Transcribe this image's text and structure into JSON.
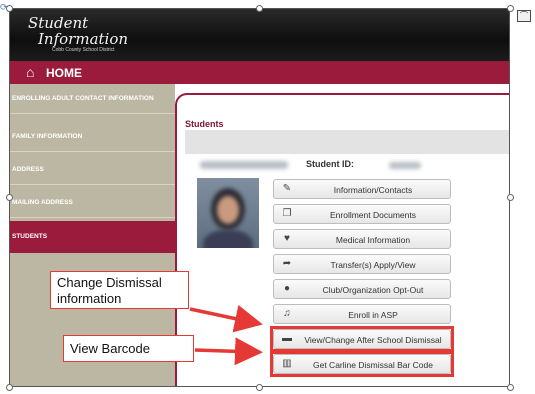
{
  "header": {
    "logo_line1": "Student",
    "logo_line2": "Information",
    "logo_sub": "Cobb County School District"
  },
  "homebar": {
    "icon": "home-icon",
    "label": "HOME"
  },
  "sidebar": {
    "items": [
      {
        "label": "ENROLLING ADULT CONTACT INFORMATION",
        "active": false
      },
      {
        "label": "FAMILY INFORMATION",
        "active": false
      },
      {
        "label": "ADDRESS",
        "active": false
      },
      {
        "label": "MAILING ADDRESS",
        "active": false
      },
      {
        "label": "STUDENTS",
        "active": true
      }
    ]
  },
  "main": {
    "section_title": "Students",
    "student_id_label": "Student ID:",
    "menu": [
      {
        "icon": "pencil-icon",
        "label": "Information/Contacts"
      },
      {
        "icon": "documents-icon",
        "label": "Enrollment Documents"
      },
      {
        "icon": "heart-monitor-icon",
        "label": "Medical Information"
      },
      {
        "icon": "share-arrow-icon",
        "label": "Transfer(s) Apply/View"
      },
      {
        "icon": "person-minus-icon",
        "label": "Club/Organization Opt-Out"
      },
      {
        "icon": "bell-icon",
        "label": "Enroll in ASP"
      },
      {
        "icon": "bus-icon",
        "label": "View/Change After School Dismissal"
      },
      {
        "icon": "barcode-icon",
        "label": "Get Carline Dismissal Bar Code"
      }
    ]
  },
  "callouts": {
    "dismissal": "Change Dismissal information",
    "barcode": "View Barcode"
  },
  "colors": {
    "brand": "#9b1b3d",
    "sidebar": "#bcb7a2",
    "annotation": "#e53935"
  }
}
